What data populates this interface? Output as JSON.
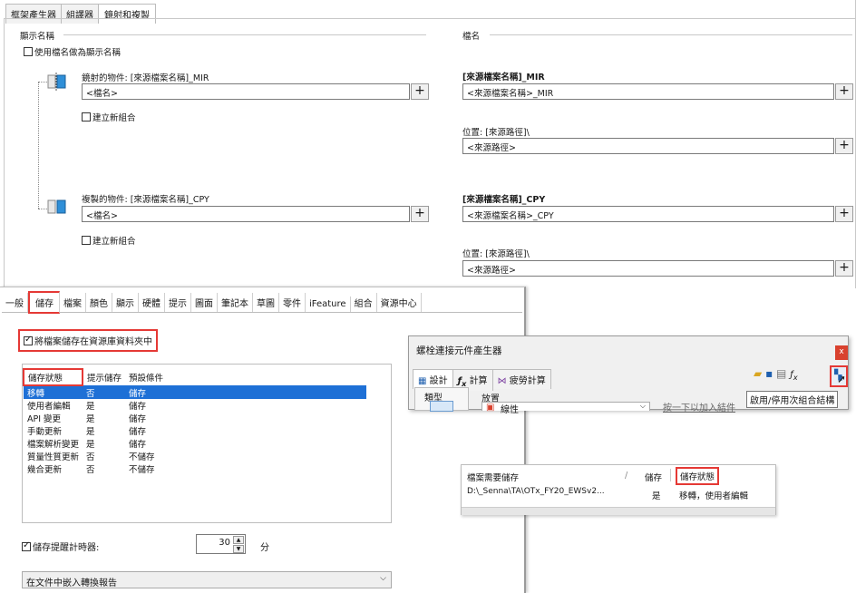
{
  "mirror_panel": {
    "tabs": [
      "框架產生器",
      "組譯器",
      "鏡射和複製"
    ],
    "display_name_header": "顯示名稱",
    "filename_header": "檔名",
    "use_filename_checkbox": "使用檔名做為顯示名稱",
    "mirrored_title": "鏡射的物件: [來源檔案名稱]_MIR",
    "mirrored_input": "<檔名>",
    "mirrored_new_assembly": "建立新組合",
    "copied_title": "複製的物件: [來源檔案名稱]_CPY",
    "copied_input": "<檔名>",
    "copied_new_assembly": "建立新組合",
    "right_mir_title": "[來源檔案名稱]_MIR",
    "right_mir_input": "<來源檔案名稱>_MIR",
    "location_label_1": "位置: [來源路徑]\\",
    "location_input_1": "<來源路徑>",
    "right_cpy_title": "[來源檔案名稱]_CPY",
    "right_cpy_input": "<來源檔案名稱>_CPY",
    "location_label_2": "位置: [來源路徑]\\",
    "location_input_2": "<來源路徑>",
    "plus": "+"
  },
  "options_panel": {
    "tabs": [
      "一般",
      "儲存",
      "檔案",
      "顏色",
      "顯示",
      "硬體",
      "提示",
      "圖面",
      "筆記本",
      "草圖",
      "零件",
      "iFeature",
      "組合",
      "資源中心"
    ],
    "save_to_library_checkbox": "將檔案儲存在資源庫資料夾中",
    "columns": [
      "儲存狀態",
      "提示儲存",
      "預設條件"
    ],
    "rows": [
      [
        "移轉",
        "否",
        "儲存"
      ],
      [
        "使用者編輯",
        "是",
        "儲存"
      ],
      [
        "API 變更",
        "是",
        "儲存"
      ],
      [
        "手動更新",
        "是",
        "儲存"
      ],
      [
        "檔案解析變更",
        "是",
        "儲存"
      ],
      [
        "質量性質更新",
        "否",
        "不儲存"
      ],
      [
        "幾合更新",
        "否",
        "不儲存"
      ]
    ],
    "timer_checkbox": "儲存提醒計時器:",
    "timer_value": "30",
    "timer_unit": "分",
    "dropdown_value": "在文件中嵌入轉換報告"
  },
  "bolt_dialog": {
    "title": "螺栓連接元件產生器",
    "close": "x",
    "tabs": [
      "設計",
      "計算",
      "疲勞計算"
    ],
    "type_label": "類型",
    "placement_label": "放置",
    "placement_value": "線性",
    "add_fastener_link": "按一下以加入結件",
    "tooltip": "啟用/停用次組合結構"
  },
  "file_table": {
    "headers": [
      "檔案需要儲存",
      "/",
      "儲存",
      "儲存狀態"
    ],
    "path": "D:\\_Senna\\TA\\OTx_FY20_EWSv2...",
    "save_value": "是",
    "status_value": "移轉，使用者編輯"
  },
  "colors": {
    "highlight_red": "#e53935",
    "selection_blue": "#1e70d6",
    "dialog_close_red": "#d9412e"
  }
}
